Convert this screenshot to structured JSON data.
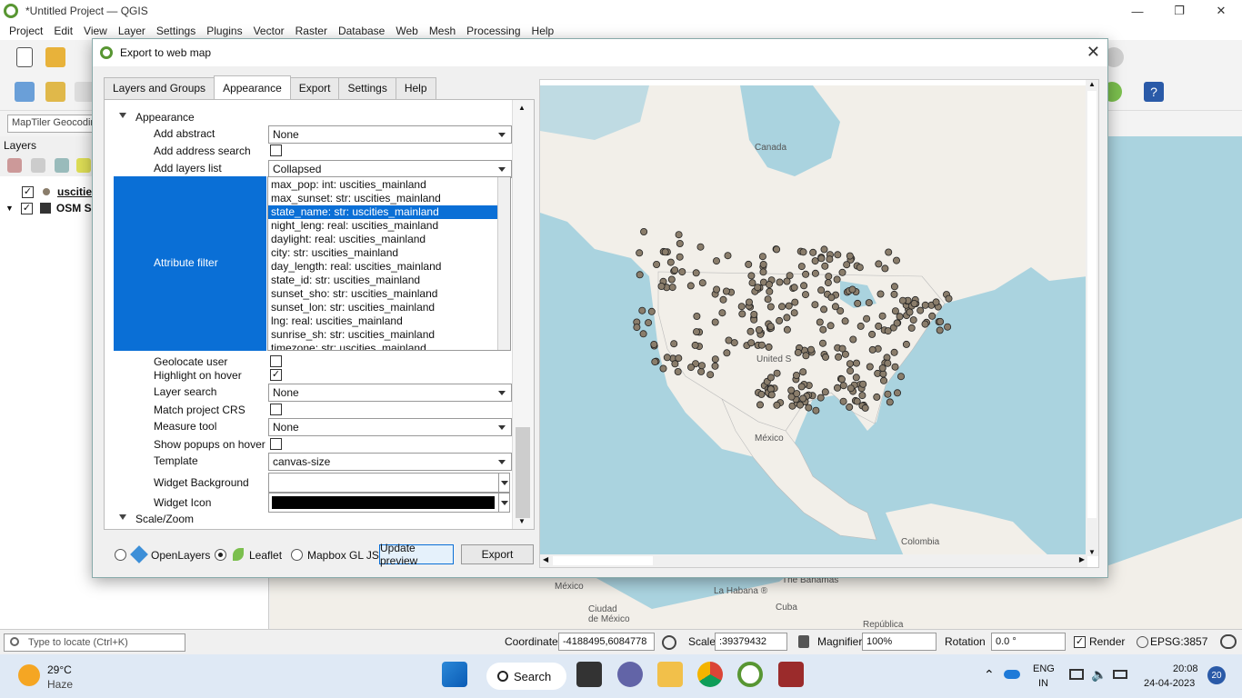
{
  "window": {
    "title": "*Untitled Project — QGIS",
    "controls": [
      "—",
      "❐",
      "✕"
    ]
  },
  "menu": [
    "Project",
    "Edit",
    "View",
    "Layer",
    "Settings",
    "Plugins",
    "Vector",
    "Raster",
    "Database",
    "Web",
    "Mesh",
    "Processing",
    "Help"
  ],
  "geocoder_placeholder": "MapTiler Geocodin",
  "layers_panel": {
    "title": "Layers",
    "layers": [
      {
        "name": "uscitie",
        "checked": true
      },
      {
        "name": "OSM S",
        "checked": true
      }
    ]
  },
  "dialog": {
    "title": "Export to web map",
    "tabs": [
      "Layers and Groups",
      "Appearance",
      "Export",
      "Settings",
      "Help"
    ],
    "active_tab": "Appearance",
    "appearance": {
      "group_label": "Appearance",
      "add_abstract": {
        "label": "Add abstract",
        "value": "None"
      },
      "add_address_search": {
        "label": "Add address search"
      },
      "add_layers_list": {
        "label": "Add layers list",
        "value": "Collapsed"
      },
      "attribute_filter": {
        "label": "Attribute filter",
        "items": [
          "max_pop: int: uscities_mainland",
          "max_sunset: str: uscities_mainland",
          "state_name: str: uscities_mainland",
          "night_leng: real: uscities_mainland",
          "daylight: real: uscities_mainland",
          "city: str: uscities_mainland",
          "day_length: real: uscities_mainland",
          "state_id: str: uscities_mainland",
          "sunset_sho: str: uscities_mainland",
          "sunset_lon: str: uscities_mainland",
          "lng: real: uscities_mainland",
          "sunrise_sh: str: uscities_mainland",
          "timezone: str: uscities_mainland"
        ],
        "selected": "state_name: str: uscities_mainland"
      },
      "geolocate_user": {
        "label": "Geolocate user"
      },
      "highlight_on_hover": {
        "label": "Highlight on hover",
        "checked_mark": "✓"
      },
      "layer_search": {
        "label": "Layer search",
        "value": "None"
      },
      "match_project_crs": {
        "label": "Match project CRS"
      },
      "measure_tool": {
        "label": "Measure tool",
        "value": "None"
      },
      "show_popups_on_hover": {
        "label": "Show popups on hover"
      },
      "template": {
        "label": "Template",
        "value": "canvas-size"
      },
      "widget_background": {
        "label": "Widget Background"
      },
      "widget_icon": {
        "label": "Widget Icon",
        "color": "#000000"
      },
      "scale_zoom": {
        "label": "Scale/Zoom"
      }
    },
    "renderers": [
      {
        "label": "OpenLayers",
        "selected": false
      },
      {
        "label": "Leaflet",
        "selected": true
      },
      {
        "label": "Mapbox GL JS",
        "selected": false
      }
    ],
    "update_preview": "Update preview",
    "export": "Export",
    "close": "✕",
    "preview_labels": {
      "canada": "Canada",
      "united_states": "United S",
      "mexico": "México",
      "colombia": "Colombia"
    }
  },
  "background_map_labels": {
    "mexico": "México",
    "ciudad": "Ciudad\nde México",
    "bahamas": "The Bahamas",
    "habana": "La Habana ®",
    "cuba": "Cuba",
    "republica": "República"
  },
  "status": {
    "locate_placeholder": "Type to locate (Ctrl+K)",
    "coordinate_label": "Coordinate",
    "coordinate_value": "-4188495,6084778",
    "scale_label": "Scale",
    "scale_value": ":39379432",
    "magnifier_label": "Magnifier",
    "magnifier_value": "100%",
    "rotation_label": "Rotation",
    "rotation_value": "0.0 °",
    "render_label": "Render",
    "crs": "EPSG:3857"
  },
  "taskbar": {
    "weather_temp": "29°C",
    "weather_desc": "Haze",
    "search": "Search",
    "lang": "ENG",
    "region": "IN",
    "time": "20:08",
    "date": "24-04-2023",
    "notifications": "20"
  },
  "colors": {
    "accent": "#0a6fd6",
    "water": "#aad3df",
    "land": "#f2efe9",
    "point": "#8a7d6b"
  }
}
